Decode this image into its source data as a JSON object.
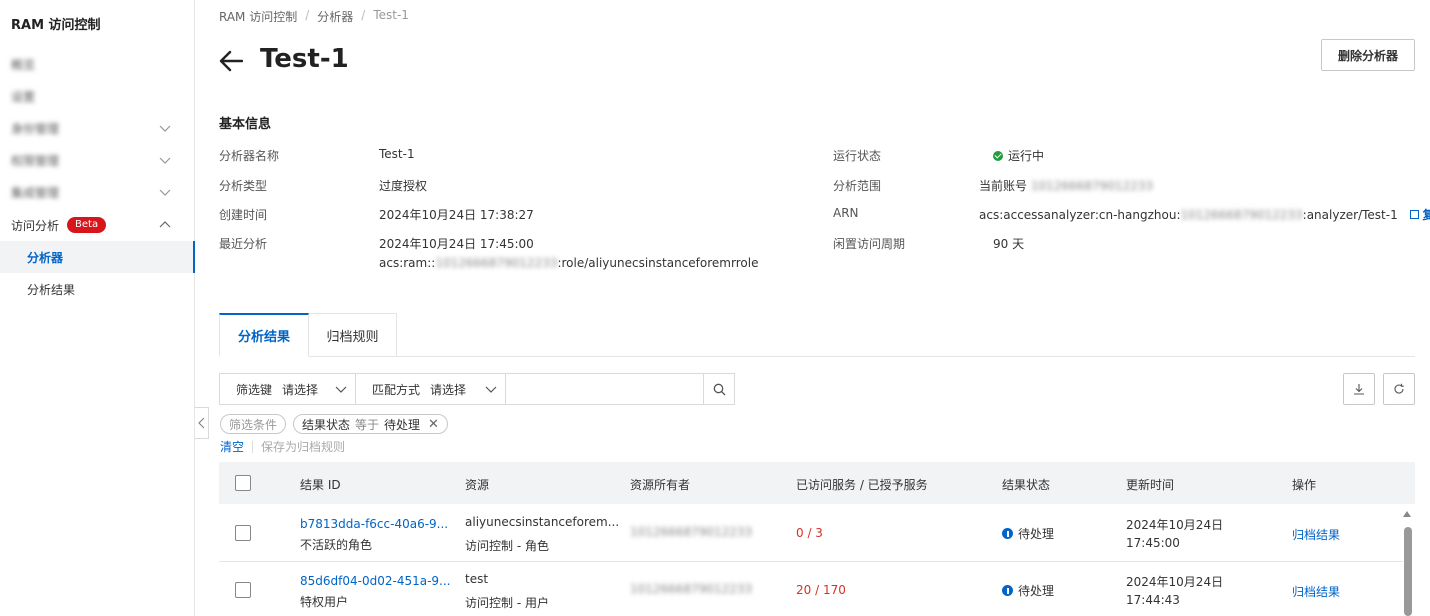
{
  "sidebar": {
    "title": "RAM 访问控制",
    "items": [
      {
        "label": "概览"
      },
      {
        "label": "设置"
      },
      {
        "label": "身份管理"
      },
      {
        "label": "权限管理"
      },
      {
        "label": "集成管理"
      },
      {
        "label": "访问分析",
        "badge": "Beta"
      },
      {
        "label": "分析器"
      },
      {
        "label": "分析结果"
      }
    ]
  },
  "breadcrumb": [
    "RAM 访问控制",
    "分析器",
    "Test-1"
  ],
  "page": {
    "title": "Test-1",
    "delete_button": "删除分析器"
  },
  "basic_info": {
    "section_title": "基本信息",
    "name_label": "分析器名称",
    "name_value": "Test-1",
    "type_label": "分析类型",
    "type_value": "过度授权",
    "created_label": "创建时间",
    "created_value": "2024年10月24日 17:38:27",
    "last_label": "最近分析",
    "last_value": "2024年10月24日 17:45:00",
    "last_arn_prefix": "acs:ram::",
    "last_arn_account": "1012666879012233",
    "last_arn_suffix": ":role/aliyunecsinstanceforemrrole",
    "status_label": "运行状态",
    "status_value": "运行中",
    "scope_label": "分析范围",
    "scope_value": "当前账号",
    "scope_account": "1012666879012233",
    "arn_label": "ARN",
    "arn_prefix": "acs:accessanalyzer:cn-hangzhou:",
    "arn_account": "1012666879012233",
    "arn_suffix": ":analyzer/Test-1",
    "copy_label": "复制",
    "idle_label": "闲置访问周期",
    "idle_value": "90 天"
  },
  "tabs": [
    {
      "label": "分析结果",
      "active": true
    },
    {
      "label": "归档规则",
      "active": false
    }
  ],
  "filter": {
    "key_label": "筛选键",
    "key_placeholder": "请选择",
    "match_label": "匹配方式",
    "match_placeholder": "请选择",
    "search_value": ""
  },
  "chips": {
    "condition": "筛选条件",
    "status_key": "结果状态",
    "status_op": "等于",
    "status_val": "待处理"
  },
  "actions": {
    "clear": "清空",
    "save": "保存为归档规则"
  },
  "table": {
    "headers": [
      "结果 ID",
      "资源",
      "资源所有者",
      "已访问服务 / 已授予服务",
      "结果状态",
      "更新时间",
      "操作"
    ],
    "rows": [
      {
        "id": "b7813dda-f6cc-40a6-9...",
        "id_desc": "不活跃的角色",
        "resource": "aliyunecsinstanceforem...",
        "resource_type": "访问控制 - 角色",
        "owner": "1012666879012233",
        "services": "0 / 3",
        "status": "待处理",
        "updated_date": "2024年10月24日",
        "updated_time": "17:45:00",
        "action": "归档结果"
      },
      {
        "id": "85d6df04-0d02-451a-9...",
        "id_desc": "特权用户",
        "resource": "test",
        "resource_type": "访问控制 - 用户",
        "owner": "1012666879012233",
        "services": "20 / 170",
        "status": "待处理",
        "updated_date": "2024年10月24日",
        "updated_time": "17:44:43",
        "action": "归档结果"
      }
    ]
  },
  "colors": {
    "accent": "#0064c8",
    "danger": "#d93026",
    "success": "#1e9f3e",
    "badge": "#d7161b"
  }
}
